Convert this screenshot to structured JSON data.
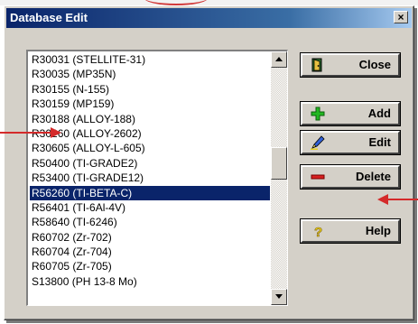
{
  "window": {
    "title": "Database Edit",
    "close_glyph": "×"
  },
  "list": {
    "items": [
      "R30031 (STELLITE-31)",
      "R30035 (MP35N)",
      "R30155 (N-155)",
      "R30159 (MP159)",
      "R30188 (ALLOY-188)",
      "R30260 (ALLOY-2602)",
      "R30605 (ALLOY-L-605)",
      "R50400 (TI-GRADE2)",
      "R53400 (TI-GRADE12)",
      "R56260 (TI-BETA-C)",
      "R56401 (TI-6Al-4V)",
      "R58640 (TI-6246)",
      "R60702 (Zr-702)",
      "R60704 (Zr-704)",
      "R60705 (Zr-705)",
      "S13800 (PH 13-8 Mo)"
    ],
    "selected_index": 9
  },
  "buttons": {
    "close": {
      "label": "Close",
      "icon": "exit-door-icon"
    },
    "add": {
      "label": "Add",
      "icon": "green-plus-icon"
    },
    "edit": {
      "label": "Edit",
      "icon": "pen-icon"
    },
    "delete": {
      "label": "Delete",
      "icon": "red-minus-icon"
    },
    "help": {
      "label": "Help",
      "icon": "question-mark-icon"
    }
  },
  "colors": {
    "title_bar_start": "#0a246a",
    "selection": "#0a246a",
    "annotation_arrow": "#d42a2a",
    "dialog_face": "#d4d0c8"
  }
}
